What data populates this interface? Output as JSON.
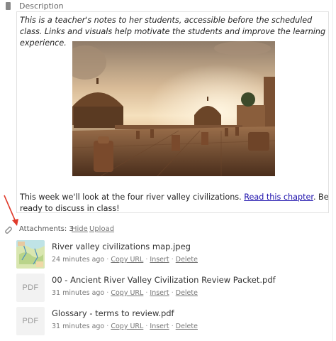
{
  "description": {
    "label": "Description",
    "intro": "This is a teacher's notes to her students, accessible before the scheduled class. Links and visuals help motivate the students and improve the learning experience.",
    "outro_before": "This week we'll look at the four river valley civilizations. ",
    "outro_link": "Read this chapter",
    "outro_after": ". Be ready to discuss in class!"
  },
  "attachments": {
    "count_label": "Attachments: 3",
    "hide_label": "Hide",
    "upload_label": "Upload",
    "items": [
      {
        "name": "River valley civilizations map.jpeg",
        "age": "24 minutes ago",
        "thumb": "map",
        "copy_url": "Copy URL",
        "insert": "Insert",
        "delete": "Delete"
      },
      {
        "name": "00 - Ancient River Valley Civilization Review Packet.pdf",
        "age": "31 minutes ago",
        "thumb": "PDF",
        "copy_url": "Copy URL",
        "insert": "Insert",
        "delete": "Delete"
      },
      {
        "name": "Glossary - terms to review.pdf",
        "age": "31 minutes ago",
        "thumb": "PDF",
        "copy_url": "Copy URL",
        "insert": "Insert",
        "delete": "Delete"
      }
    ]
  },
  "colors": {
    "link": "#1a0dab",
    "annotation_arrow": "#e03a2b",
    "pdf_thumb_bg": "#f2f2f2"
  }
}
